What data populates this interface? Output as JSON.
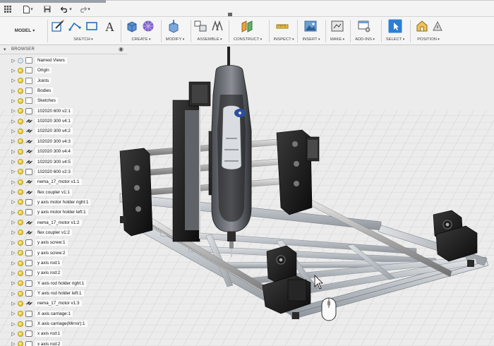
{
  "workspace": "MODEL",
  "toolbar": {
    "groups": [
      "SKETCH",
      "CREATE",
      "MODIFY",
      "ASSEMBLE",
      "CONSTRUCT",
      "INSPECT",
      "INSERT",
      "MAKE",
      "ADD-INS",
      "SELECT",
      "POSITION"
    ]
  },
  "browser": {
    "title": "BROWSER",
    "items": [
      {
        "label": "Named Views",
        "icon": "folder-icon",
        "bulb": false
      },
      {
        "label": "Origin",
        "icon": "folder-icon",
        "bulb": true
      },
      {
        "label": "Joints",
        "icon": "folder-icon",
        "bulb": true
      },
      {
        "label": "Bodies",
        "icon": "folder-icon",
        "bulb": true
      },
      {
        "label": "Sketches",
        "icon": "folder-icon",
        "bulb": true
      },
      {
        "label": "102020 600 v2:1",
        "icon": "component-icon",
        "bulb": true
      },
      {
        "label": "102020 300 v4:1",
        "icon": "link-icon",
        "bulb": true
      },
      {
        "label": "102020 300 v4:2",
        "icon": "link-icon",
        "bulb": true
      },
      {
        "label": "102020 300 v4:3",
        "icon": "link-icon",
        "bulb": true
      },
      {
        "label": "102020 300 v4:4",
        "icon": "link-icon",
        "bulb": true
      },
      {
        "label": "102020 300 v4:5",
        "icon": "link-icon",
        "bulb": true
      },
      {
        "label": "102020 600 v2:3",
        "icon": "component-icon",
        "bulb": true
      },
      {
        "label": "nema_17_motor v1:1",
        "icon": "link-icon",
        "bulb": true
      },
      {
        "label": "flex coupler v1:1",
        "icon": "link-icon",
        "bulb": true
      },
      {
        "label": "y axis motor holder right:1",
        "icon": "component-icon",
        "bulb": true
      },
      {
        "label": "y axis motor holder left:1",
        "icon": "component-icon",
        "bulb": true
      },
      {
        "label": "nema_17_motor v1:2",
        "icon": "link-icon",
        "bulb": true
      },
      {
        "label": "flex coupler v1:2",
        "icon": "link-icon",
        "bulb": true
      },
      {
        "label": "y axis screw:1",
        "icon": "component-icon",
        "bulb": true
      },
      {
        "label": "y axis screw:2",
        "icon": "component-icon",
        "bulb": true
      },
      {
        "label": "y axis rod:1",
        "icon": "component-icon",
        "bulb": true
      },
      {
        "label": "y axis rod:2",
        "icon": "component-icon",
        "bulb": true
      },
      {
        "label": "Y axis rod holder right:1",
        "icon": "component-icon",
        "bulb": true
      },
      {
        "label": "Y axis rod holder left:1",
        "icon": "component-icon",
        "bulb": true
      },
      {
        "label": "nema_17_motor v1:3",
        "icon": "link-icon",
        "bulb": true
      },
      {
        "label": "X axis carriage:1",
        "icon": "component-icon",
        "bulb": true
      },
      {
        "label": "X axis carriage(Mirror):1",
        "icon": "component-icon",
        "bulb": true
      },
      {
        "label": "x axis rod:1",
        "icon": "component-icon",
        "bulb": true
      },
      {
        "label": "x axis rod:2",
        "icon": "component-icon",
        "bulb": true
      }
    ]
  },
  "colors": {
    "accent": "#2a7fd4",
    "grid_line": "#c8c8c8",
    "aluminium": "#bfc3c8",
    "printed_part": "#1b1b1b"
  }
}
